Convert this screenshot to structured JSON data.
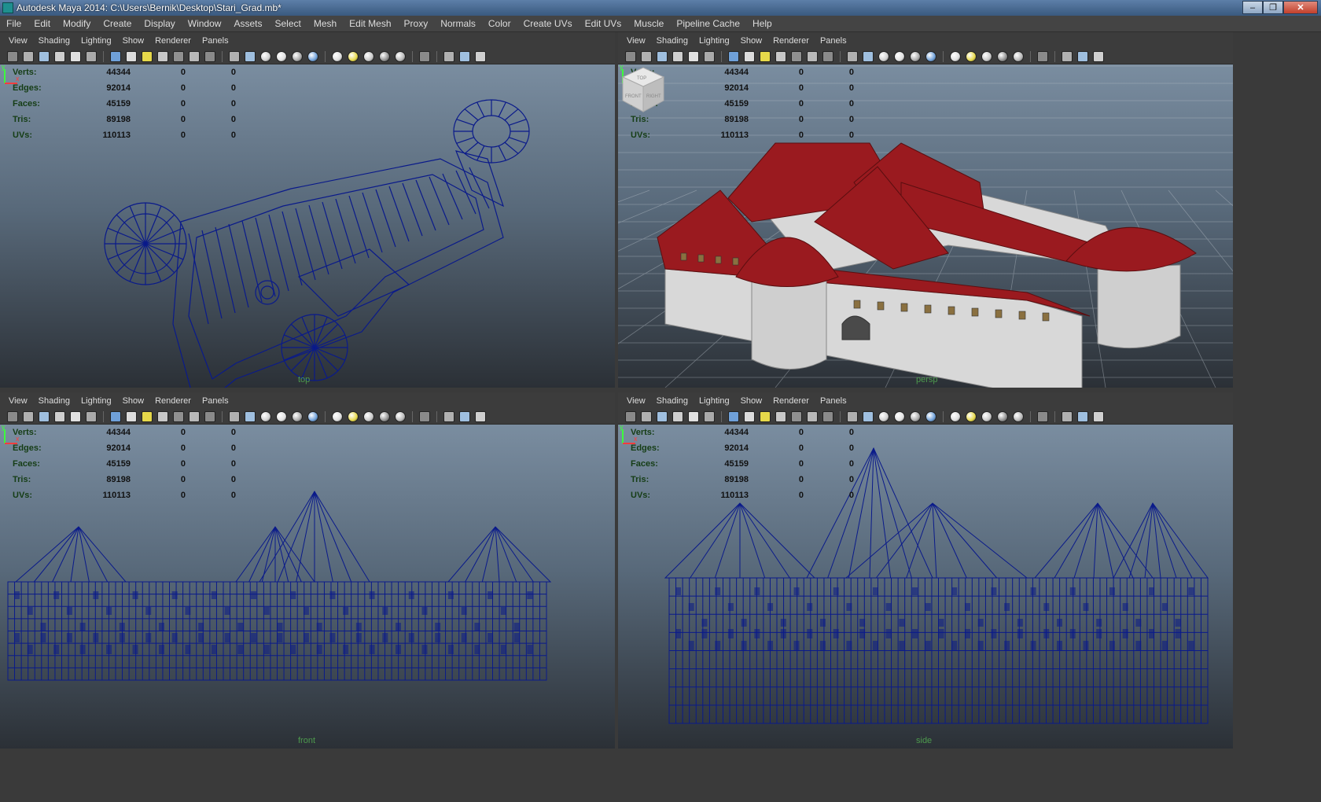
{
  "window": {
    "title": "Autodesk Maya 2014: C:\\Users\\Bernik\\Desktop\\Stari_Grad.mb*",
    "min": "–",
    "max": "❐",
    "close": "✕"
  },
  "menubar": [
    "File",
    "Edit",
    "Modify",
    "Create",
    "Display",
    "Window",
    "Assets",
    "Select",
    "Mesh",
    "Edit Mesh",
    "Proxy",
    "Normals",
    "Color",
    "Create UVs",
    "Edit UVs",
    "Muscle",
    "Pipeline Cache",
    "Help"
  ],
  "panel_menu": [
    "View",
    "Shading",
    "Lighting",
    "Show",
    "Renderer",
    "Panels"
  ],
  "hud": {
    "labels": [
      "Verts:",
      "Edges:",
      "Faces:",
      "Tris:",
      "UVs:"
    ],
    "values": [
      [
        "44344",
        "0",
        "0"
      ],
      [
        "92014",
        "0",
        "0"
      ],
      [
        "45159",
        "0",
        "0"
      ],
      [
        "89198",
        "0",
        "0"
      ],
      [
        "110113",
        "0",
        "0"
      ]
    ]
  },
  "viewports": [
    {
      "name": "top-view",
      "camera": "top"
    },
    {
      "name": "persp-view",
      "camera": "persp"
    },
    {
      "name": "front-view",
      "camera": "front"
    },
    {
      "name": "side-view",
      "camera": "side"
    }
  ],
  "colors": {
    "wire": "#0a1a8a",
    "roof": "#9a1a1f",
    "wall": "#d8d8d8",
    "grid": "#2a2d32"
  },
  "viewcube": {
    "top": "TOP",
    "front": "FRONT",
    "right": "RIGHT"
  }
}
